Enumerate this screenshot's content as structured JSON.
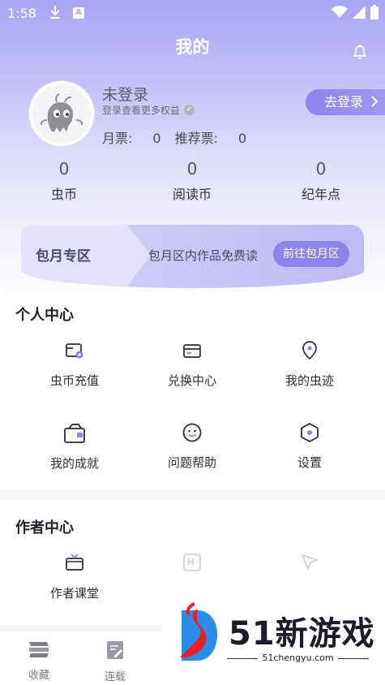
{
  "status_bar": {
    "time": "1:58"
  },
  "header": {
    "title": "我的"
  },
  "profile": {
    "username": "未登录",
    "hint": "登录查看更多权益",
    "monthly_ticket_label": "月票:",
    "monthly_ticket_value": "0",
    "recommend_ticket_label": "推荐票:",
    "recommend_ticket_value": "0",
    "login_button": "去登录"
  },
  "stats": [
    {
      "value": "0",
      "label": "虫币"
    },
    {
      "value": "0",
      "label": "阅读币"
    },
    {
      "value": "0",
      "label": "纪年点"
    }
  ],
  "monthly_zone": {
    "title": "包月专区",
    "description": "包月区内作品免费读",
    "button": "前往包月区"
  },
  "personal_center": {
    "title": "个人中心",
    "items": [
      {
        "label": "虫币充值",
        "icon": "wallet-plus-icon"
      },
      {
        "label": "兑换中心",
        "icon": "card-icon"
      },
      {
        "label": "我的虫迹",
        "icon": "location-pin-icon"
      },
      {
        "label": "我的成就",
        "icon": "achievement-box-icon"
      },
      {
        "label": "问题帮助",
        "icon": "smiley-icon"
      },
      {
        "label": "设置",
        "icon": "settings-hexagon-icon"
      }
    ]
  },
  "author_center": {
    "title": "作者中心",
    "items": [
      {
        "label": "作者课堂",
        "icon": "tv-icon"
      }
    ]
  },
  "tabbar": [
    {
      "label": "收藏",
      "icon": "bookshelf-icon"
    },
    {
      "label": "连载",
      "icon": "edit-doc-icon"
    }
  ],
  "watermark": {
    "text": "51新游戏",
    "url": "51chengyu.com"
  },
  "colors": {
    "accent": "#8c84e8",
    "header_gradient_top": "#a9a4f3",
    "text_primary": "#222228"
  }
}
